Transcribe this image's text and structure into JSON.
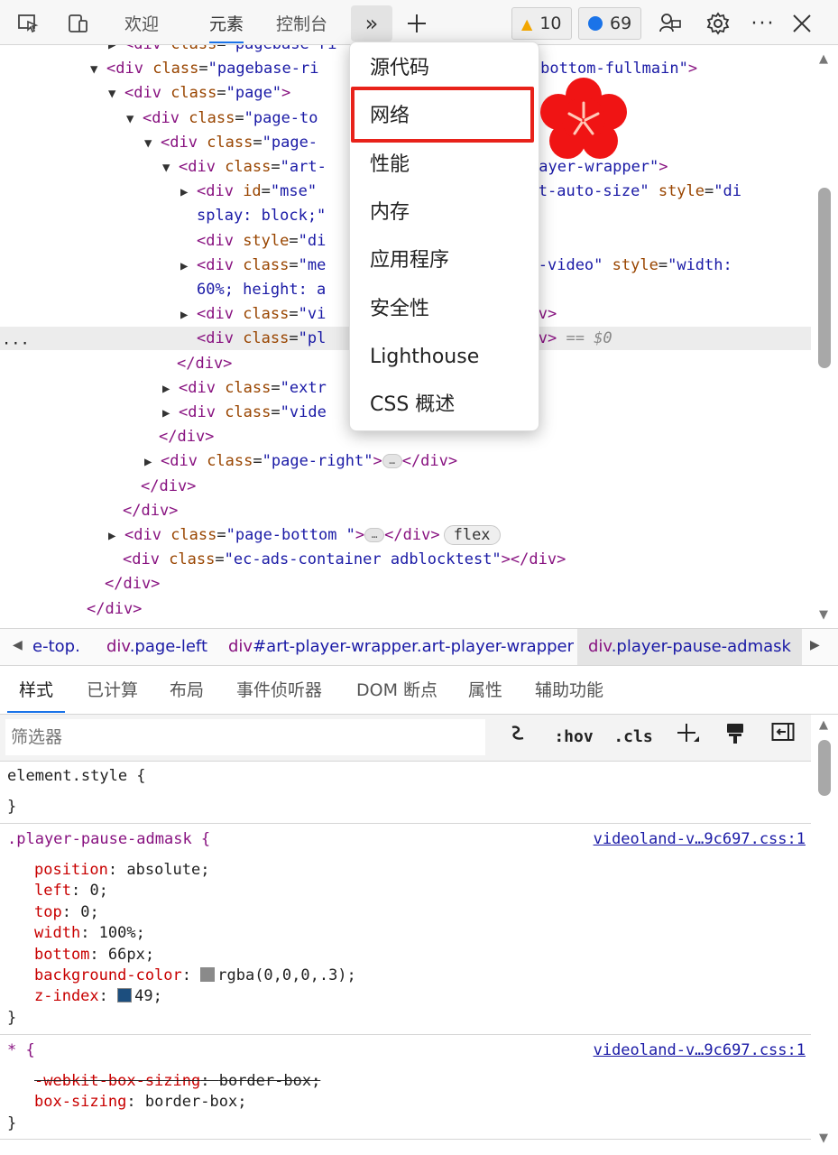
{
  "toolbar": {
    "tabs": [
      "欢迎",
      "元素",
      "控制台"
    ],
    "active_tab": "元素",
    "warnings_count": "10",
    "messages_count": "69"
  },
  "tree": {
    "lines": [
      {
        "indent": 138,
        "arrow": "▶",
        "html": [
          [
            "tg",
            "<div "
          ],
          [
            "at",
            "class"
          ],
          [
            "tx",
            "="
          ],
          [
            "av",
            "\"pagebase-ri"
          ]
        ]
      },
      {
        "indent": 118,
        "arrow": "▼",
        "html": [
          [
            "tg",
            "<div "
          ],
          [
            "at",
            "class"
          ],
          [
            "tx",
            "="
          ],
          [
            "av",
            "\"pagebase-ri"
          ],
          [
            "tx",
            "                 "
          ],
          [
            "av",
            "-right-bottom-fullmain\""
          ],
          [
            "tg",
            ">"
          ]
        ]
      },
      {
        "indent": 138,
        "arrow": "▼",
        "html": [
          [
            "tg",
            "<div "
          ],
          [
            "at",
            "class"
          ],
          [
            "tx",
            "="
          ],
          [
            "av",
            "\"page\""
          ],
          [
            "tg",
            ">"
          ]
        ]
      },
      {
        "indent": 158,
        "arrow": "▼",
        "html": [
          [
            "tg",
            "<div "
          ],
          [
            "at",
            "class"
          ],
          [
            "tx",
            "="
          ],
          [
            "av",
            "\"page-to"
          ]
        ]
      },
      {
        "indent": 178,
        "arrow": "▼",
        "html": [
          [
            "tg",
            "<div "
          ],
          [
            "at",
            "class"
          ],
          [
            "tx",
            "="
          ],
          [
            "av",
            "\"page-"
          ]
        ]
      },
      {
        "indent": 198,
        "arrow": "▼",
        "html": [
          [
            "tg",
            "<div "
          ],
          [
            "at",
            "class"
          ],
          [
            "tx",
            "="
          ],
          [
            "av",
            "\"art-"
          ],
          [
            "tx",
            "                "
          ],
          [
            "av",
            "\"art-player-wrapper\""
          ],
          [
            "tg",
            ">"
          ]
        ]
      },
      {
        "indent": 218,
        "arrow": "▶",
        "html": [
          [
            "tg",
            "<div "
          ],
          [
            "at",
            "id"
          ],
          [
            "tx",
            "="
          ],
          [
            "av",
            "\"mse\""
          ],
          [
            "tx",
            "                   "
          ],
          [
            "av",
            "er art-auto-size\""
          ],
          [
            "tx",
            " "
          ],
          [
            "at",
            "style"
          ],
          [
            "tx",
            "="
          ],
          [
            "av",
            "\"di"
          ]
        ]
      },
      {
        "indent": 218,
        "arrow": "",
        "html": [
          [
            "av",
            "splay: block;\""
          ]
        ]
      },
      {
        "indent": 218,
        "arrow": "",
        "html": [
          [
            "tg",
            "<div "
          ],
          [
            "at",
            "style"
          ],
          [
            "tx",
            "="
          ],
          [
            "av",
            "\"di"
          ],
          [
            "tx",
            "                    "
          ],
          [
            "tg",
            ">"
          ]
        ]
      },
      {
        "indent": 218,
        "arrow": "▶",
        "html": [
          [
            "tg",
            "<div "
          ],
          [
            "at",
            "class"
          ],
          [
            "tx",
            "="
          ],
          [
            "av",
            "\"me"
          ],
          [
            "tx",
            "                 "
          ],
          [
            "av",
            "-pause-video\""
          ],
          [
            "tx",
            " "
          ],
          [
            "at",
            "style"
          ],
          [
            "tx",
            "="
          ],
          [
            "av",
            "\"width:"
          ]
        ]
      },
      {
        "indent": 218,
        "arrow": "",
        "html": [
          [
            "av",
            "60%; height: a"
          ]
        ]
      },
      {
        "indent": 218,
        "arrow": "▶",
        "html": [
          [
            "tg",
            "<div "
          ],
          [
            "at",
            "class"
          ],
          [
            "tx",
            "="
          ],
          [
            "av",
            "\"vi"
          ],
          [
            "tx",
            "                   "
          ],
          [
            "tg",
            "</div>"
          ]
        ]
      },
      {
        "indent": 218,
        "arrow": "",
        "sel": true,
        "html": [
          [
            "tg",
            "<div "
          ],
          [
            "at",
            "class"
          ],
          [
            "tx",
            "="
          ],
          [
            "av",
            "\"pl"
          ],
          [
            "tx",
            "                   "
          ],
          [
            "tg",
            "</div>"
          ],
          [
            "tx",
            " "
          ],
          [
            "cm",
            "== $0"
          ]
        ]
      },
      {
        "indent": 196,
        "arrow": "",
        "html": [
          [
            "tg",
            "</div>"
          ]
        ]
      },
      {
        "indent": 198,
        "arrow": "▶",
        "html": [
          [
            "tg",
            "<div "
          ],
          [
            "at",
            "class"
          ],
          [
            "tx",
            "="
          ],
          [
            "av",
            "\"extr"
          ]
        ]
      },
      {
        "indent": 198,
        "arrow": "▶",
        "html": [
          [
            "tg",
            "<div "
          ],
          [
            "at",
            "class"
          ],
          [
            "tx",
            "="
          ],
          [
            "av",
            "\"vide"
          ]
        ]
      },
      {
        "indent": 176,
        "arrow": "",
        "html": [
          [
            "tg",
            "</div>"
          ]
        ]
      },
      {
        "indent": 178,
        "arrow": "▶",
        "html": [
          [
            "tg",
            "<div "
          ],
          [
            "at",
            "class"
          ],
          [
            "tx",
            "="
          ],
          [
            "av",
            "\"page-right\""
          ],
          [
            "tg",
            ">"
          ],
          [
            "ell",
            "…"
          ],
          [
            "tg",
            "</div>"
          ]
        ]
      },
      {
        "indent": 156,
        "arrow": "",
        "html": [
          [
            "tg",
            "</div>"
          ]
        ]
      },
      {
        "indent": 136,
        "arrow": "",
        "html": [
          [
            "tg",
            "</div>"
          ]
        ]
      },
      {
        "indent": 138,
        "arrow": "▶",
        "html": [
          [
            "tg",
            "<div "
          ],
          [
            "at",
            "class"
          ],
          [
            "tx",
            "="
          ],
          [
            "av",
            "\"page-bottom \""
          ],
          [
            "tg",
            ">"
          ],
          [
            "ell",
            "…"
          ],
          [
            "tg",
            "</div>"
          ],
          [
            "flex",
            "flex"
          ]
        ]
      },
      {
        "indent": 136,
        "arrow": "",
        "html": [
          [
            "tg",
            "<div "
          ],
          [
            "at",
            "class"
          ],
          [
            "tx",
            "="
          ],
          [
            "av",
            "\"ec-ads-container adblocktest\""
          ],
          [
            "tg",
            "></div>"
          ]
        ]
      },
      {
        "indent": 116,
        "arrow": "",
        "html": [
          [
            "tg",
            "</div>"
          ]
        ]
      },
      {
        "indent": 96,
        "arrow": "",
        "html": [
          [
            "tg",
            "</div>"
          ]
        ]
      }
    ]
  },
  "breadcrumbs": {
    "items": [
      {
        "tag": "",
        "cls": "e-top."
      },
      {
        "tag": "div",
        "cls": ".page-left"
      },
      {
        "tag": "div",
        "cls": "#art-player-wrapper.art-player-wrapper"
      },
      {
        "tag": "div",
        "cls": ".player-pause-admask"
      }
    ]
  },
  "styles_tabs": [
    "样式",
    "已计算",
    "布局",
    "事件侦听器",
    "DOM 断点",
    "属性",
    "辅助功能"
  ],
  "filter": {
    "placeholder": "筛选器",
    "hov": ":hov",
    "cls": ".cls"
  },
  "rules": {
    "element_style": {
      "selector": "element.style {",
      "close": "}"
    },
    "admask": {
      "selector": ".player-pause-admask {",
      "source": "videoland-v…9c697.css:1",
      "props": [
        {
          "name": "position",
          "value": "absolute;"
        },
        {
          "name": "left",
          "value": "0;"
        },
        {
          "name": "top",
          "value": "0;"
        },
        {
          "name": "width",
          "value": "100%;"
        },
        {
          "name": "bottom",
          "value": "66px;"
        },
        {
          "name": "background-color",
          "value": "rgba(0,0,0,.3);",
          "swatch": "gray"
        },
        {
          "name": "z-index",
          "value": "49;",
          "swatch": "z"
        }
      ],
      "close": "}"
    },
    "star": {
      "selector": "* {",
      "source": "videoland-v…9c697.css:1",
      "props": [
        {
          "name": "-webkit-box-sizing",
          "value": "border-box;",
          "strike": true
        },
        {
          "name": "box-sizing",
          "value": "border-box;"
        }
      ],
      "close": "}"
    }
  },
  "menu": {
    "items": [
      "源代码",
      "网络",
      "性能",
      "内存",
      "应用程序",
      "安全性",
      "Lighthouse",
      "CSS 概述"
    ],
    "highlighted": "网络"
  },
  "colors": {
    "highlight": "#e8221a",
    "accent": "#1a73e8",
    "flower": "#f01414"
  }
}
